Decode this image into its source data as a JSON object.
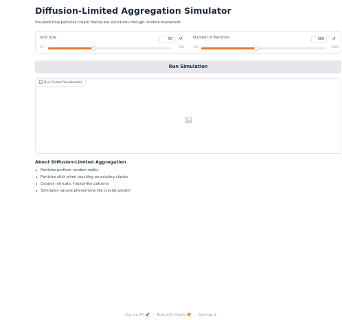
{
  "app": {
    "title": "Diffusion-Limited Aggregation Simulator",
    "subtitle": "Visualize how particles create fractal-like structures through random movement"
  },
  "controls": {
    "grid_size": {
      "label": "Grid Size",
      "value": "50",
      "min": "20",
      "max": "100"
    },
    "particles": {
      "label": "Number of Particles",
      "value": "500",
      "min": "100",
      "max": "1000"
    }
  },
  "run_button": {
    "label": "Run Simulation"
  },
  "visualization": {
    "label": "DLA Cluster Visualization"
  },
  "about": {
    "title": "About Diffusion-Limited Aggregation",
    "items": [
      "Particles perform random walks",
      "Particles stick when touching an existing cluster",
      "Creates intricate, fractal-like patterns",
      "Simulates natural phenomena like crystal growth"
    ]
  },
  "footer": {
    "api": "Use via API",
    "built": "Built with Gradio",
    "settings": "Settings"
  },
  "colors": {
    "accent": "#ea7627",
    "button_bg": "#e5e7eb",
    "border": "#e5e7eb"
  }
}
